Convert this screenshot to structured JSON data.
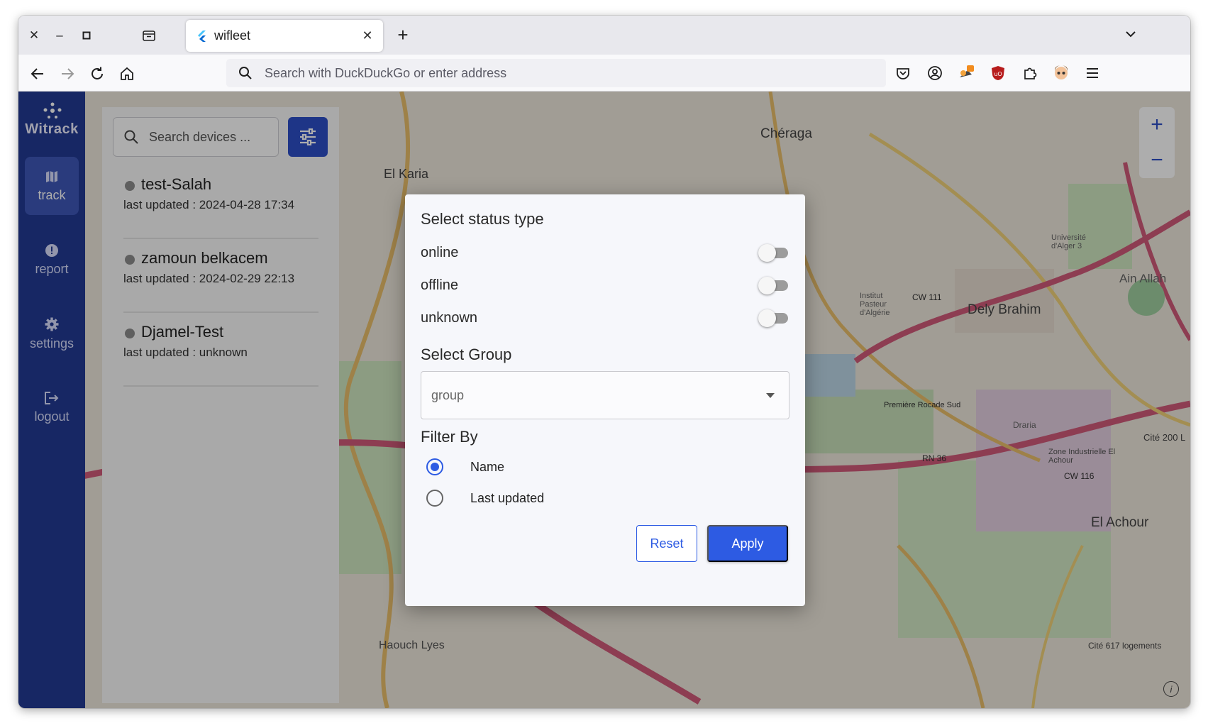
{
  "browser": {
    "tab_title": "wifleet",
    "address_placeholder": "Search with DuckDuckGo or enter address"
  },
  "app": {
    "logo_text": "Witrack",
    "rail": [
      {
        "label": "track",
        "icon": "map-icon",
        "active": true
      },
      {
        "label": "report",
        "icon": "alert-icon",
        "active": false
      },
      {
        "label": "settings",
        "icon": "gear-icon",
        "active": false
      },
      {
        "label": "logout",
        "icon": "logout-icon",
        "active": false
      }
    ],
    "search_placeholder": "Search devices ...",
    "devices": [
      {
        "name": "test-Salah",
        "updated": "last updated : 2024-04-28 17:34"
      },
      {
        "name": "zamoun belkacem",
        "updated": "last updated : 2024-02-29 22:13"
      },
      {
        "name": "Djamel-Test",
        "updated": "last updated : unknown"
      }
    ]
  },
  "map": {
    "labels": [
      "El Karia",
      "Chéraga",
      "Dely Brahim",
      "El Achour",
      "Ain Allah",
      "Haouch Lyes",
      "Première Rocade Sud",
      "CW 111",
      "RN 36",
      "CW 116",
      "Cité 200 L",
      "Cité 617 logements",
      "Draria",
      "Université d'Alger 3",
      "Zone Industrielle El Achour",
      "Institut Pasteur d'Algérie"
    ]
  },
  "dialog": {
    "title": "Select status type",
    "statuses": [
      {
        "label": "online",
        "enabled": false
      },
      {
        "label": "offline",
        "enabled": false
      },
      {
        "label": "unknown",
        "enabled": false
      }
    ],
    "group_title": "Select Group",
    "group_value": "group",
    "filter_title": "Filter By",
    "filter_options": [
      {
        "label": "Name",
        "selected": true
      },
      {
        "label": "Last updated",
        "selected": false
      }
    ],
    "reset_label": "Reset",
    "apply_label": "Apply"
  },
  "colors": {
    "primary": "#2d5be3",
    "sidebar": "#223a94",
    "filter_button": "#2d4ec8"
  }
}
